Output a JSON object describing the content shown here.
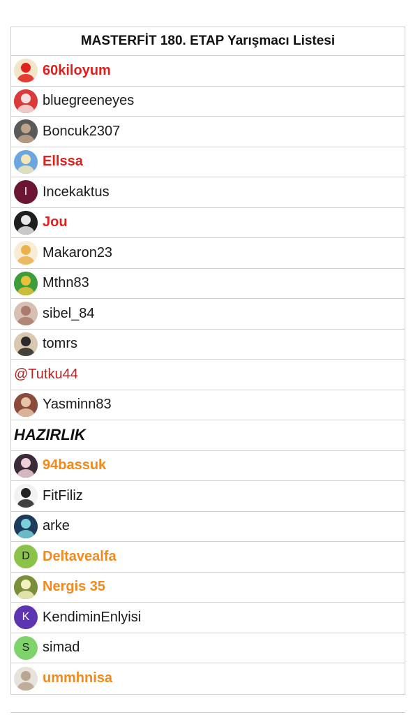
{
  "title": "MASTERFİT 180. ETAP Yarışmacı Listesi",
  "rows": [
    {
      "name": "60kiloyum",
      "style": "red",
      "avatar": {
        "icon": "dancer-avatar",
        "bg": "#f3e5c8",
        "fg": "#e0201c"
      }
    },
    {
      "name": "bluegreeneyes",
      "style": "normal",
      "avatar": {
        "icon": "flowers-avatar",
        "bg": "#d93a3a",
        "fg": "#f4e0e0"
      }
    },
    {
      "name": "Boncuk2307",
      "style": "normal",
      "avatar": {
        "icon": "couple-avatar",
        "bg": "#5a5a5a",
        "fg": "#bfa38a"
      }
    },
    {
      "name": "Ellssa",
      "style": "red",
      "avatar": {
        "icon": "princess-avatar",
        "bg": "#6aa6e0",
        "fg": "#f3e7b8"
      }
    },
    {
      "name": "Incekaktus",
      "style": "normal",
      "avatar": {
        "icon": "letter-avatar",
        "bg": "#6b1433",
        "letter": "I",
        "fg": "#ffffff"
      }
    },
    {
      "name": "Jou",
      "style": "red",
      "avatar": {
        "icon": "sketch-avatar",
        "bg": "#1e1e1e",
        "fg": "#e8e8e8"
      }
    },
    {
      "name": "Makaron23",
      "style": "normal",
      "avatar": {
        "icon": "doll-avatar",
        "bg": "#f8ecd4",
        "fg": "#e9b24b"
      }
    },
    {
      "name": "Mthn83",
      "style": "normal",
      "avatar": {
        "icon": "garden-avatar",
        "bg": "#3c9d3a",
        "fg": "#e7c23a"
      }
    },
    {
      "name": "sibel_84",
      "style": "normal",
      "avatar": {
        "icon": "hands-avatar",
        "bg": "#d8bfb4",
        "fg": "#a97b6b"
      }
    },
    {
      "name": "tomrs",
      "style": "normal",
      "avatar": {
        "icon": "portrait-avatar",
        "bg": "#d9c7b0",
        "fg": "#2a2a2a"
      }
    },
    {
      "name": "@Tutku44",
      "style": "mention",
      "avatar": null
    },
    {
      "name": "Yasminn83",
      "style": "normal",
      "avatar": {
        "icon": "woman-avatar",
        "bg": "#8a4b3a",
        "fg": "#e8c4a8"
      }
    },
    {
      "name": "HAZIRLIK",
      "style": "section",
      "avatar": null
    },
    {
      "name": "94bassuk",
      "style": "orange",
      "avatar": {
        "icon": "anime-avatar",
        "bg": "#3a2a3a",
        "fg": "#f0d0d8"
      }
    },
    {
      "name": "FitFiliz",
      "style": "normal",
      "avatar": {
        "icon": "panda-avatar",
        "bg": "#f2f2f2",
        "fg": "#222222"
      }
    },
    {
      "name": "arke",
      "style": "normal",
      "avatar": {
        "icon": "abstract-avatar",
        "bg": "#1d3b5c",
        "fg": "#7ad0d8"
      }
    },
    {
      "name": "Deltavealfa",
      "style": "orange",
      "avatar": {
        "icon": "letter-avatar",
        "bg": "#8bc34a",
        "letter": "D",
        "fg": "#1e1e1e"
      }
    },
    {
      "name": "Nergis 35",
      "style": "orange",
      "avatar": {
        "icon": "flower-avatar",
        "bg": "#7a8f3a",
        "fg": "#f4f0c0"
      }
    },
    {
      "name": "KendiminEnlyisi",
      "style": "normal",
      "avatar": {
        "icon": "letter-avatar",
        "bg": "#5e35b1",
        "letter": "K",
        "fg": "#ffffff"
      }
    },
    {
      "name": "simad",
      "style": "normal",
      "avatar": {
        "icon": "letter-avatar",
        "bg": "#7ed36b",
        "letter": "S",
        "fg": "#1e1e1e"
      }
    },
    {
      "name": "ummhnisa",
      "style": "orange",
      "avatar": {
        "icon": "family-avatar",
        "bg": "#e6e2dc",
        "fg": "#b8a58e"
      }
    }
  ]
}
